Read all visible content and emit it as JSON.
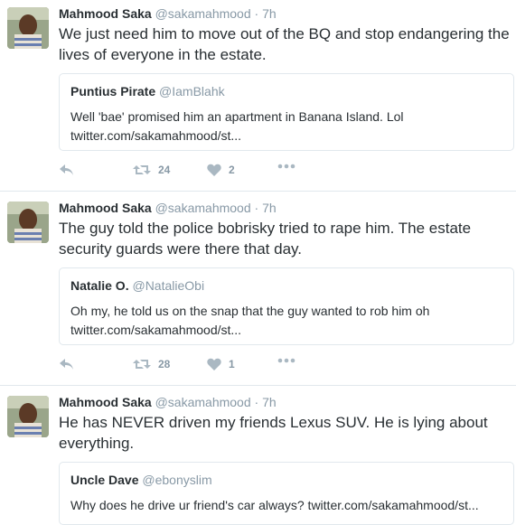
{
  "tweets": [
    {
      "author_name": "Mahmood Saka",
      "author_handle": "@sakamahmood",
      "separator": "·",
      "time": "7h",
      "text": "We just need him to move out of the BQ and stop endangering the lives of everyone in the estate.",
      "quote": {
        "name": "Puntius Pirate",
        "handle": "@IamBlahk",
        "text": "Well 'bae' promised him an apartment in Banana Island. Lol twitter.com/sakamahmood/st..."
      },
      "retweets": "24",
      "likes": "2"
    },
    {
      "author_name": "Mahmood Saka",
      "author_handle": "@sakamahmood",
      "separator": "·",
      "time": "7h",
      "text": "The guy told the police bobrisky tried to rape him. The estate security guards were there that day.",
      "quote": {
        "name": "Natalie O.",
        "handle": "@NatalieObi",
        "text": "Oh my, he told us on the snap that the guy wanted to rob him oh twitter.com/sakamahmood/st..."
      },
      "retweets": "28",
      "likes": "1"
    },
    {
      "author_name": "Mahmood Saka",
      "author_handle": "@sakamahmood",
      "separator": "·",
      "time": "7h",
      "text": "He has NEVER driven my friends Lexus SUV. He is lying about everything.",
      "quote": {
        "name": "Uncle Dave",
        "handle": "@ebonyslim",
        "text": "Why does he drive ur friend's car always? twitter.com/sakamahmood/st..."
      }
    }
  ],
  "icons": {
    "reply": "reply-icon",
    "retweet": "retweet-icon",
    "like": "heart-icon",
    "more": "more-icon"
  },
  "colors": {
    "text": "#292f33",
    "muted": "#8899a6",
    "icon": "#aab8c2",
    "border": "#e1e8ed"
  }
}
